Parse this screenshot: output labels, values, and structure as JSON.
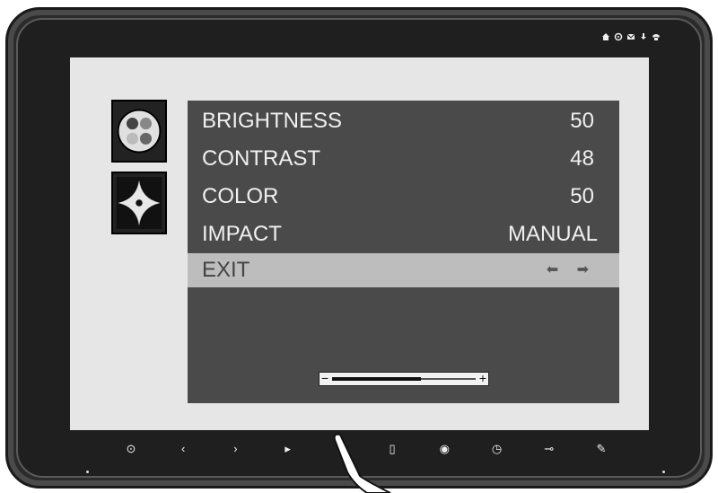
{
  "menu": {
    "rows": [
      {
        "label": "BRIGHTNESS",
        "value": "50"
      },
      {
        "label": "CONTRAST",
        "value": "48"
      },
      {
        "label": "COLOR",
        "value": "50"
      },
      {
        "label": "IMPACT",
        "value": "MANUAL"
      }
    ],
    "exit_label": "EXIT",
    "exit_arrows": "⬅ ➡"
  },
  "slider": {
    "minus": "−",
    "plus": "+",
    "level_fraction": 0.62
  },
  "colors": {
    "menu_bg": "#4a4a4a",
    "exit_bg": "#bdbdbd",
    "screen_bg": "#e6e6e6",
    "bezel": "#2b2b2b"
  },
  "icons": {
    "top_side": "color-dots-icon",
    "bottom_side": "geometry-icon",
    "status": [
      "home-icon",
      "settings-icon",
      "mail-icon",
      "download-icon",
      "phone-icon"
    ],
    "bottom_bar": [
      "power-icon",
      "left-arrow-icon",
      "right-arrow-icon",
      "input-icon",
      "menu-icon",
      "document-icon",
      "circle-icon",
      "clock-icon",
      "key-icon",
      "pen-icon"
    ]
  }
}
